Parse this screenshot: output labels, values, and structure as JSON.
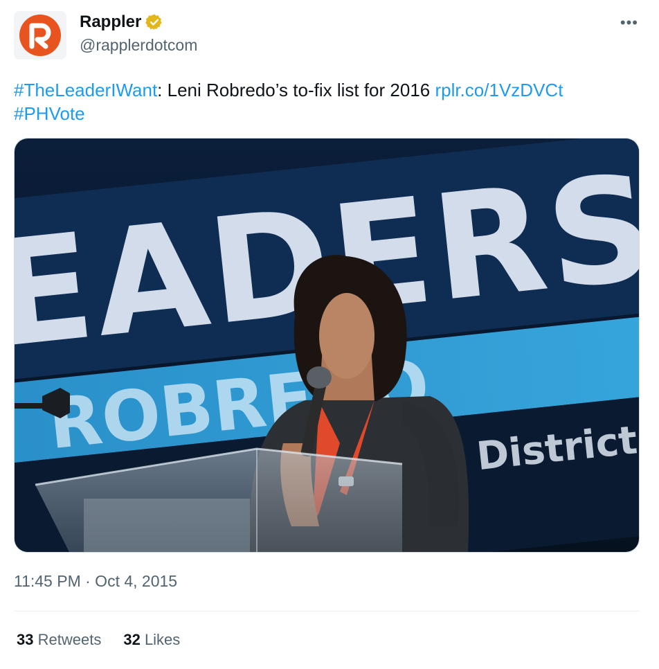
{
  "author": {
    "display_name": "Rappler",
    "handle": "@rapplerdotcom",
    "avatar_icon": "rappler-logo-icon",
    "verified_icon": "verified-badge-icon",
    "verified_color": "#e2b719",
    "brand_color": "#e8541f"
  },
  "menu": {
    "more_label": "•••"
  },
  "tweet": {
    "hashtag_1": "#TheLeaderIWant",
    "text_1": ": Leni Robredo’s to-fix list for 2016 ",
    "link": "rplr.co/1VzDVCt",
    "hashtag_2": "#PHVote",
    "link_color": "#1d9bf0"
  },
  "media": {
    "screen_text_big": "EADERSHI",
    "screen_text_name": "ROBREDO",
    "screen_text_small": "District, Ho"
  },
  "meta": {
    "timestamp": "11:45 PM · Oct 4, 2015"
  },
  "stats": {
    "retweets_count": "33",
    "retweets_label": "Retweets",
    "likes_count": "32",
    "likes_label": "Likes"
  }
}
